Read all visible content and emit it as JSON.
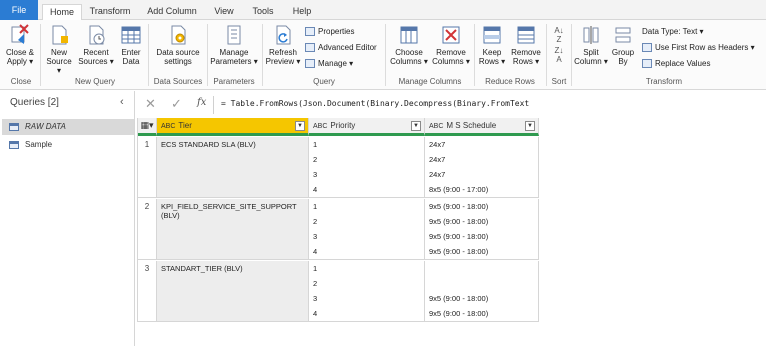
{
  "tabs": [
    {
      "label": "File"
    },
    {
      "label": "Home"
    },
    {
      "label": "Transform"
    },
    {
      "label": "Add Column"
    },
    {
      "label": "View"
    },
    {
      "label": "Tools"
    },
    {
      "label": "Help"
    }
  ],
  "ribbon": {
    "close_apply": "Close & Apply ▾",
    "new_source": "New Source ▾",
    "recent_sources": "Recent Sources ▾",
    "enter_data": "Enter Data",
    "data_source_settings": "Data source settings",
    "manage_parameters": "Manage Parameters ▾",
    "refresh_preview": "Refresh Preview ▾",
    "properties": "Properties",
    "advanced_editor": "Advanced Editor",
    "manage": "Manage ▾",
    "choose_columns": "Choose Columns ▾",
    "remove_columns": "Remove Columns ▾",
    "keep_rows": "Keep Rows ▾",
    "remove_rows": "Remove Rows ▾",
    "split_column": "Split Column ▾",
    "group_by": "Group By",
    "data_type": "Data Type: Text ▾",
    "use_first_row": "Use First Row as Headers ▾",
    "replace_values": "Replace Values",
    "groups": {
      "close": "Close",
      "new_query": "New Query",
      "data_sources": "Data Sources",
      "parameters": "Parameters",
      "query": "Query",
      "manage_columns": "Manage Columns",
      "reduce_rows": "Reduce Rows",
      "sort": "Sort",
      "transform": "Transform"
    }
  },
  "queries": {
    "title": "Queries [2]",
    "items": [
      {
        "label": "RAW DATA"
      },
      {
        "label": "Sample"
      }
    ]
  },
  "formula": {
    "fx": "fx",
    "text": "= Table.FromRows(Json.Document(Binary.Decompress(Binary.FromText"
  },
  "grid": {
    "columns": [
      {
        "type": "ABC",
        "label": "Tier"
      },
      {
        "type": "ABC",
        "label": "Priority"
      },
      {
        "type": "ABC",
        "label": "M S Schedule"
      }
    ],
    "rows": [
      {
        "num": "1",
        "tier": "ECS STANDARD SLA (BLV)",
        "priority": [
          "1",
          "2",
          "3",
          "4"
        ],
        "schedule": [
          "24x7",
          "24x7",
          "24x7",
          "8x5 (9:00 - 17:00)"
        ]
      },
      {
        "num": "2",
        "tier": "KPI_FIELD_SERVICE_SITE_SUPPORT (BLV)",
        "priority": [
          "1",
          "2",
          "3",
          "4"
        ],
        "schedule": [
          "9x5 (9:00 - 18:00)",
          "9x5 (9:00 - 18:00)",
          "9x5 (9:00 - 18:00)",
          "9x5 (9:00 - 18:00)"
        ]
      },
      {
        "num": "3",
        "tier": "STANDART_TIER (BLV)",
        "priority": [
          "1",
          "2",
          "3",
          "4"
        ],
        "schedule": [
          "",
          "",
          "9x5 (9:00 - 18:00)",
          "9x5 (9:00 - 18:00)"
        ]
      }
    ]
  }
}
